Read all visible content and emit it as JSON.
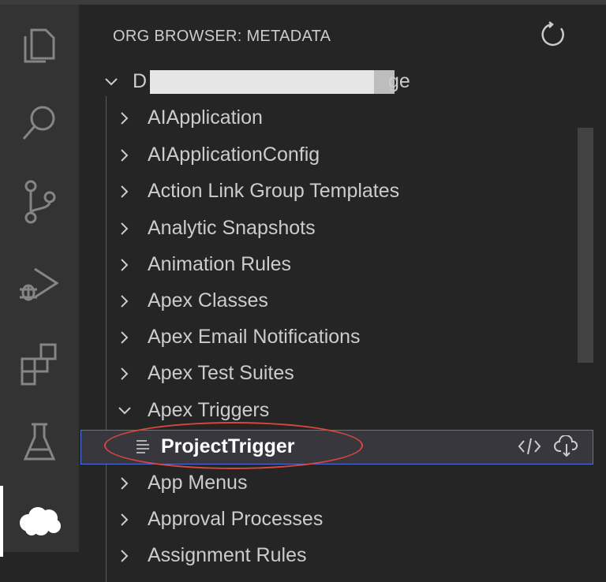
{
  "activity_bar": {
    "items": [
      {
        "name": "explorer-icon"
      },
      {
        "name": "search-icon"
      },
      {
        "name": "source-control-icon"
      },
      {
        "name": "run-debug-icon"
      },
      {
        "name": "extensions-icon"
      },
      {
        "name": "testing-icon"
      },
      {
        "name": "salesforce-cloud-icon"
      }
    ]
  },
  "sidebar": {
    "title": "ORG BROWSER: METADATA",
    "refresh_icon": "refresh-icon",
    "org": {
      "label_start": "D",
      "label_end": "ge"
    },
    "items": [
      {
        "label": "AIApplication",
        "expanded": false
      },
      {
        "label": "AIApplicationConfig",
        "expanded": false
      },
      {
        "label": "Action Link Group Templates",
        "expanded": false
      },
      {
        "label": "Analytic Snapshots",
        "expanded": false
      },
      {
        "label": "Animation Rules",
        "expanded": false
      },
      {
        "label": "Apex Classes",
        "expanded": false
      },
      {
        "label": "Apex Email Notifications",
        "expanded": false
      },
      {
        "label": "Apex Test Suites",
        "expanded": false
      },
      {
        "label": "Apex Triggers",
        "expanded": true
      },
      {
        "label": "App Menus",
        "expanded": false
      },
      {
        "label": "Approval Processes",
        "expanded": false
      },
      {
        "label": "Assignment Rules",
        "expanded": false
      }
    ],
    "selected_child": {
      "label": "ProjectTrigger",
      "icon": "file-lines-icon",
      "actions": [
        "open-code-icon",
        "retrieve-cloud-icon"
      ]
    }
  },
  "colors": {
    "highlight_border": "#4f6fdb",
    "annotation": "#d9473b"
  }
}
